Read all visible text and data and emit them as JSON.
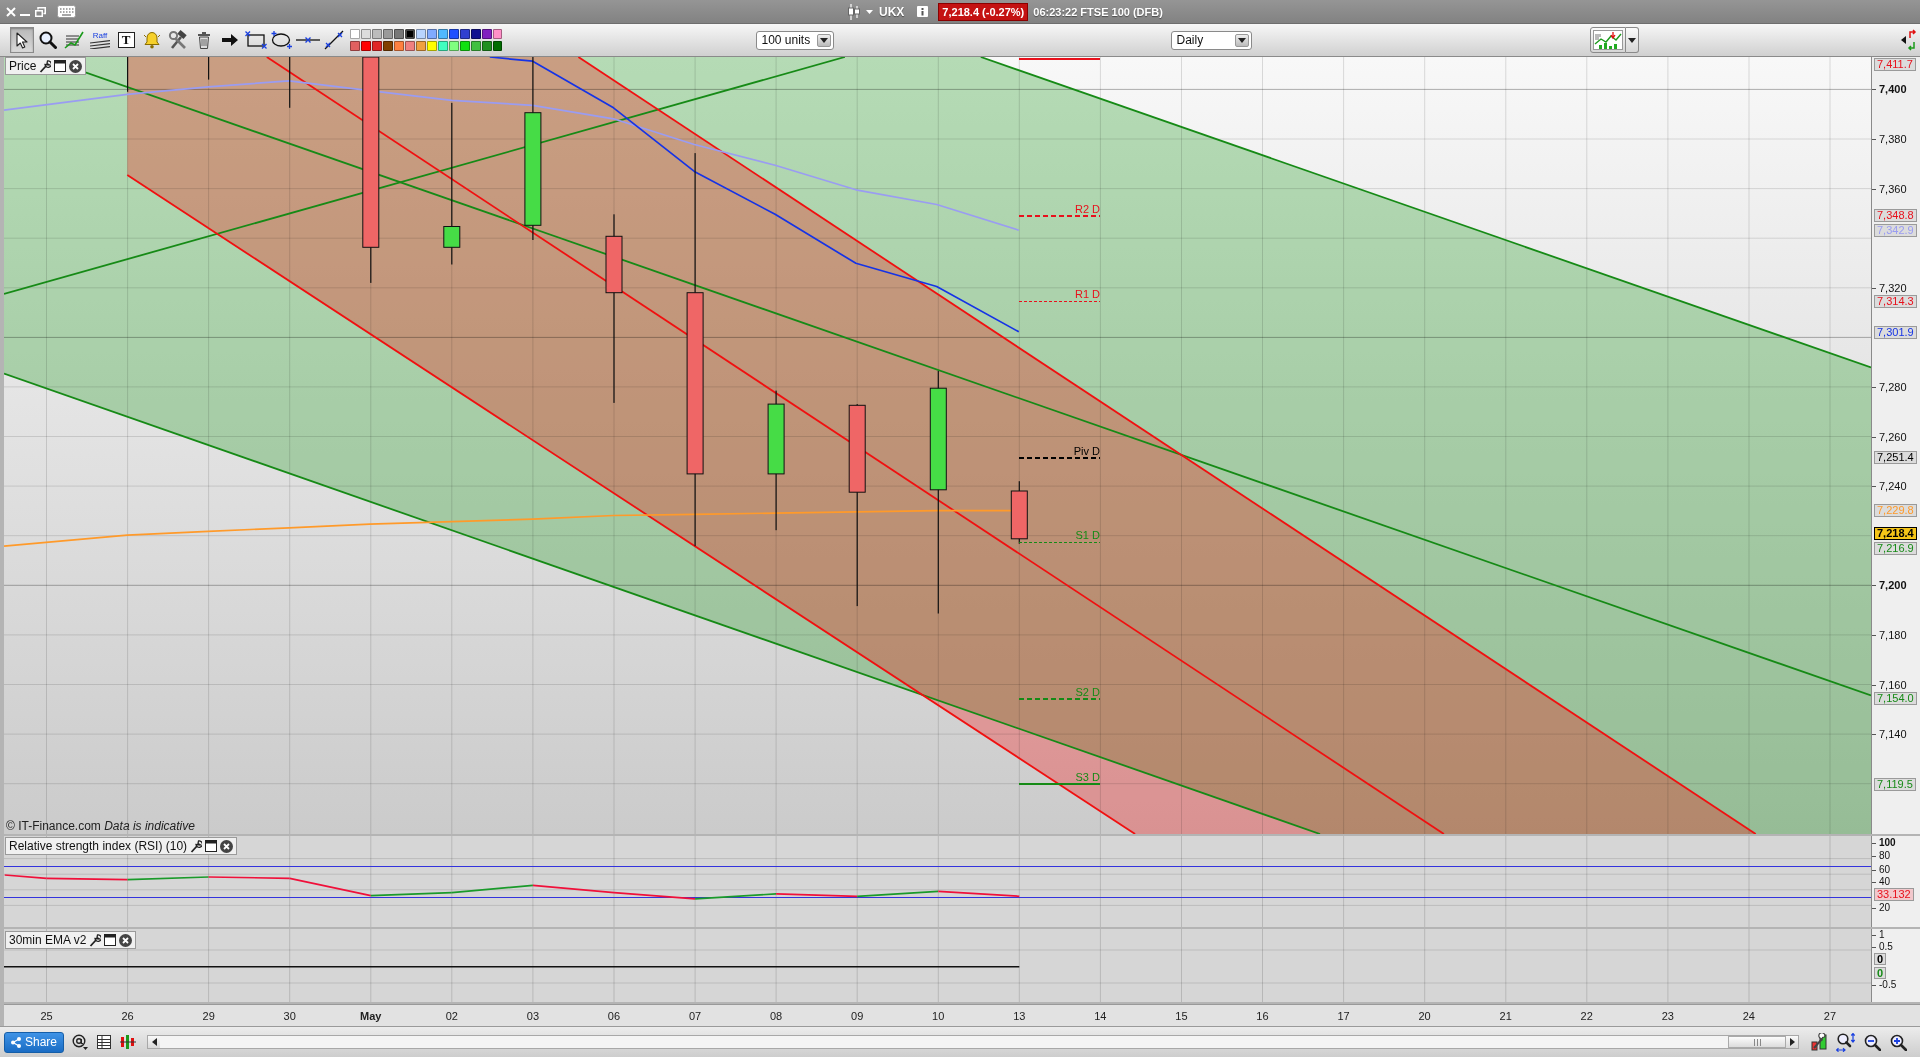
{
  "title_bar": {
    "symbol": "UKX",
    "price_badge": "7,218.4 (-0.27%)",
    "status": "06:23:22 FTSE 100 (DFB)"
  },
  "toolbar": {
    "tools": [
      {
        "kind": "pointer",
        "selected": true
      },
      {
        "kind": "magnifier",
        "selected": false
      },
      {
        "kind": "study",
        "selected": false
      },
      {
        "kind": "raff",
        "label": "Raff",
        "selected": false
      },
      {
        "kind": "text",
        "label": "T",
        "selected": false
      },
      {
        "kind": "alert",
        "selected": false
      },
      {
        "kind": "tools",
        "selected": false
      },
      {
        "kind": "delete",
        "selected": false
      },
      {
        "kind": "arrow",
        "selected": false
      },
      {
        "kind": "rectangle",
        "selected": false
      },
      {
        "kind": "ellipse",
        "selected": false
      },
      {
        "kind": "hline",
        "selected": false
      },
      {
        "kind": "trendline",
        "selected": false
      }
    ],
    "palette": [
      {
        "color": "#ffffff",
        "selected": false
      },
      {
        "color": "#dcdcdc",
        "selected": false
      },
      {
        "color": "#bcbcbc",
        "selected": false
      },
      {
        "color": "#9a9a9a",
        "selected": false
      },
      {
        "color": "#787878",
        "selected": false
      },
      {
        "color": "#000000",
        "selected": true
      },
      {
        "color": "#b8d4ff",
        "selected": false
      },
      {
        "color": "#80aaff",
        "selected": false
      },
      {
        "color": "#50b8ff",
        "selected": false
      },
      {
        "color": "#2050ff",
        "selected": false
      },
      {
        "color": "#3040d0",
        "selected": false
      },
      {
        "color": "#101090",
        "selected": false
      },
      {
        "color": "#8020c0",
        "selected": false
      },
      {
        "color": "#ff90c8",
        "selected": false
      },
      {
        "color": "#e06060",
        "selected": false
      },
      {
        "color": "#ff0000",
        "selected": false
      },
      {
        "color": "#e02828",
        "selected": false
      },
      {
        "color": "#804000",
        "selected": false
      },
      {
        "color": "#ff8040",
        "selected": false
      },
      {
        "color": "#f08080",
        "selected": false
      },
      {
        "color": "#f0a040",
        "selected": false
      },
      {
        "color": "#ffff00",
        "selected": false
      },
      {
        "color": "#40ffc0",
        "selected": false
      },
      {
        "color": "#80ff80",
        "selected": false
      },
      {
        "color": "#10e010",
        "selected": false
      },
      {
        "color": "#40c040",
        "selected": false
      },
      {
        "color": "#209020",
        "selected": false
      },
      {
        "color": "#006c00",
        "selected": false
      }
    ],
    "units": "100 units",
    "period": "Daily"
  },
  "price_panel": {
    "title": "Price",
    "ticks": [
      {
        "label": "7,400",
        "major": true
      },
      {
        "label": "7,380",
        "major": false
      },
      {
        "label": "7,360",
        "major": false
      },
      {
        "label": "7,320",
        "major": false
      },
      {
        "label": "7,280",
        "major": false
      },
      {
        "label": "7,260",
        "major": false
      },
      {
        "label": "7,240",
        "major": false
      },
      {
        "label": "7,200",
        "major": true
      },
      {
        "label": "7,180",
        "major": false
      },
      {
        "label": "7,160",
        "major": false
      },
      {
        "label": "7,140",
        "major": false
      }
    ],
    "tags": [
      {
        "text": "7,411.7",
        "color": "#e8101c",
        "current": false
      },
      {
        "text": "7,348.8",
        "color": "#e8101c",
        "current": false
      },
      {
        "text": "7,342.9",
        "color": "#9a9cf2",
        "current": false
      },
      {
        "text": "7,314.3",
        "color": "#e8101c",
        "current": false
      },
      {
        "text": "7,301.9",
        "color": "#1533e6",
        "current": false
      },
      {
        "text": "7,251.4",
        "color": "#000000",
        "current": false
      },
      {
        "text": "7,229.8",
        "color": "#ff9a2a",
        "current": false
      },
      {
        "text": "7,218.4",
        "color": "#000000",
        "current": true
      },
      {
        "text": "7,216.9",
        "color": "#168a16",
        "current": false
      },
      {
        "text": "7,154.0",
        "color": "#168a16",
        "current": false
      },
      {
        "text": "7,119.5",
        "color": "#168a16",
        "current": false
      }
    ],
    "pivots": [
      {
        "label": "R2 D",
        "color": "#e8101c",
        "kind": "dashed"
      },
      {
        "label": "R1 D",
        "color": "#e8101c",
        "kind": "fine"
      },
      {
        "label": "Piv D",
        "color": "#000000",
        "kind": "dashed"
      },
      {
        "label": "S1 D",
        "color": "#168a16",
        "kind": "fine"
      },
      {
        "label": "S2 D",
        "color": "#168a16",
        "kind": "dashed"
      },
      {
        "label": "S3 D",
        "color": "#168a16",
        "kind": "solid"
      }
    ],
    "copyright": "© IT-Finance.com  *Data is indicative*"
  },
  "rsi_panel": {
    "title": "Relative strength index (RSI) (10)",
    "ticks": [
      {
        "label": "100",
        "major": true
      },
      {
        "label": "80",
        "major": false
      },
      {
        "label": "60",
        "major": false
      },
      {
        "label": "40",
        "major": false
      },
      {
        "label": "20",
        "major": false
      }
    ],
    "tag": {
      "text": "33.132",
      "color": "#e8101c"
    }
  },
  "ema_panel": {
    "title": "30min EMA v2",
    "ticks": [
      "1",
      "0.5",
      "-0.5"
    ],
    "tags": [
      {
        "text": "0",
        "color": "#000000"
      },
      {
        "text": "0",
        "color": "#168a16"
      }
    ]
  },
  "date_axis": [
    {
      "label": "25",
      "major": false
    },
    {
      "label": "26",
      "major": false
    },
    {
      "label": "29",
      "major": false
    },
    {
      "label": "30",
      "major": false
    },
    {
      "label": "May",
      "major": true
    },
    {
      "label": "02",
      "major": false
    },
    {
      "label": "03",
      "major": false
    },
    {
      "label": "06",
      "major": false
    },
    {
      "label": "07",
      "major": false
    },
    {
      "label": "08",
      "major": false
    },
    {
      "label": "09",
      "major": false
    },
    {
      "label": "10",
      "major": false
    },
    {
      "label": "13",
      "major": false
    },
    {
      "label": "14",
      "major": false
    },
    {
      "label": "15",
      "major": false
    },
    {
      "label": "16",
      "major": false
    },
    {
      "label": "17",
      "major": false
    },
    {
      "label": "20",
      "major": false
    },
    {
      "label": "21",
      "major": false
    },
    {
      "label": "22",
      "major": false
    },
    {
      "label": "23",
      "major": false
    },
    {
      "label": "24",
      "major": false
    },
    {
      "label": "27",
      "major": false
    }
  ],
  "bottom_bar": {
    "share": "Share"
  }
}
